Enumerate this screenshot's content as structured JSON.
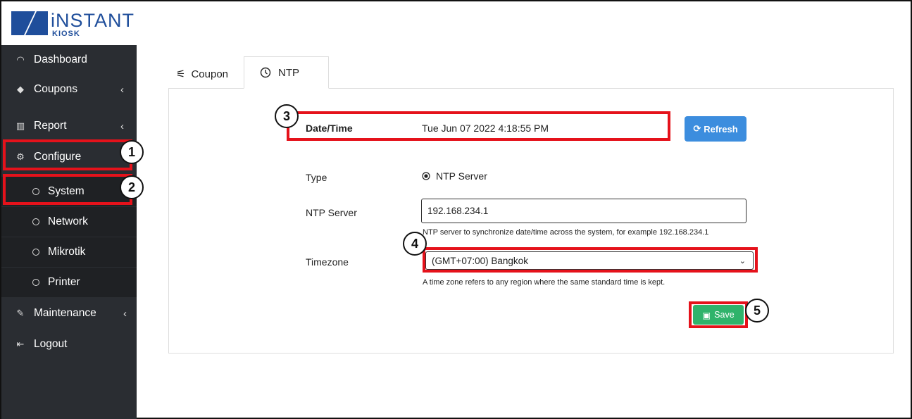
{
  "brand": {
    "name": "iNSTANT",
    "sub": "KIOSK"
  },
  "sidebar": {
    "items": [
      {
        "label": "Dashboard",
        "icon": "dashboard-icon"
      },
      {
        "label": "Coupons",
        "icon": "tag-icon"
      },
      {
        "label": "Report",
        "icon": "bar-chart-icon"
      },
      {
        "label": "Configure",
        "icon": "gear-icon"
      },
      {
        "label": "Maintenance",
        "icon": "wrench-icon"
      },
      {
        "label": "Logout",
        "icon": "logout-icon"
      }
    ],
    "configure_sub": [
      {
        "label": "System"
      },
      {
        "label": "Network"
      },
      {
        "label": "Mikrotik"
      },
      {
        "label": "Printer"
      }
    ]
  },
  "tabs": [
    {
      "label": "Coupon",
      "icon": "sliders-icon"
    },
    {
      "label": "NTP",
      "icon": "clock-icon"
    }
  ],
  "form": {
    "datetime_label": "Date/Time",
    "datetime_value": "Tue Jun 07 2022 4:18:55 PM",
    "refresh_label": "Refresh",
    "type_label": "Type",
    "type_option": "NTP Server",
    "ntp_label": "NTP Server",
    "ntp_value": "192.168.234.1",
    "ntp_help": "NTP server to synchronize date/time across the system, for example 192.168.234.1",
    "tz_label": "Timezone",
    "tz_value": "(GMT+07:00) Bangkok",
    "tz_help": "A time zone refers to any region where the same standard time is kept.",
    "save_label": "Save"
  },
  "annotations": [
    "1",
    "2",
    "3",
    "4",
    "5"
  ],
  "colors": {
    "sidebar": "#2a2d32",
    "highlight": "#e5121b",
    "refresh": "#3c8dde",
    "save": "#2fb36b"
  }
}
